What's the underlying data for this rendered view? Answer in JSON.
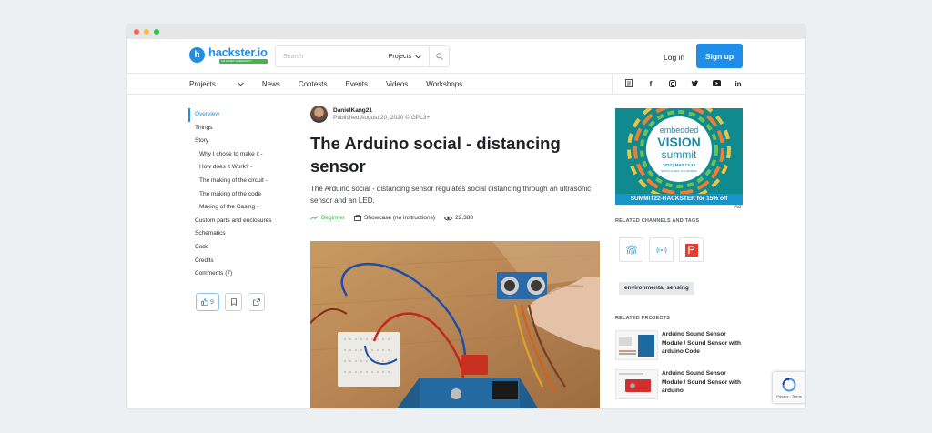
{
  "header": {
    "logo_text": "hackster.io",
    "logo_badge": "AN AVNET COMMUNITY",
    "search_placeholder": "Search",
    "search_scope": "Projects",
    "login_label": "Log in",
    "signup_label": "Sign up"
  },
  "nav": {
    "items": [
      "Projects",
      "News",
      "Contests",
      "Events",
      "Videos",
      "Workshops"
    ]
  },
  "socials": [
    "rss-icon",
    "facebook-icon",
    "instagram-icon",
    "twitter-icon",
    "youtube-icon",
    "linkedin-icon"
  ],
  "toc": {
    "items": [
      {
        "label": "Overview",
        "level": 0,
        "active": true
      },
      {
        "label": "Things",
        "level": 1
      },
      {
        "label": "Story",
        "level": 1
      },
      {
        "label": "Why I chose to make it -",
        "level": 2
      },
      {
        "label": "How does it Work? -",
        "level": 2
      },
      {
        "label": "The making of the circuit -",
        "level": 2
      },
      {
        "label": "The making of the code",
        "level": 2
      },
      {
        "label": "Making of the Casing -",
        "level": 2
      },
      {
        "label": "Custom parts and enclosures",
        "level": 1
      },
      {
        "label": "Schematics",
        "level": 1
      },
      {
        "label": "Code",
        "level": 1
      },
      {
        "label": "Credits",
        "level": 1
      },
      {
        "label": "Comments (7)",
        "level": 1
      }
    ],
    "like_count": "9"
  },
  "article": {
    "author": "DanielKang21",
    "meta": "Published August 20, 2020 © GPL3+",
    "title": "The Arduino social - distancing sensor",
    "description": "The Arduino social - distancing sensor regulates social distancing through an ultrasonic sensor and an LED.",
    "level": "Beginner",
    "type": "Showcase (no instructions)",
    "views": "22,388"
  },
  "sidebar": {
    "ad_line1": "embedded",
    "ad_line2": "VISION",
    "ad_line3": "summit",
    "ad_dates": "2022 | MAY 17-19",
    "ad_location": "SANTA CLARA, CALIFORNIA",
    "ad_promo": "SUMMIT22-HACKSTER for 15% off",
    "ad_label": "Ad",
    "channels_heading": "RELATED CHANNELS AND TAGS",
    "tag": "environmental sensing",
    "related_heading": "RELATED PROJECTS",
    "related": [
      {
        "title": "Arduino Sound Sensor Module / Sound Sensor with arduino Code"
      },
      {
        "title": "Arduino Sound Sensor Module / Sound Sensor with arduino"
      }
    ]
  },
  "captcha": {
    "label": "Privacy - Terms"
  },
  "colors": {
    "brand": "#1f8ee8",
    "beginner": "#3eb64b"
  }
}
